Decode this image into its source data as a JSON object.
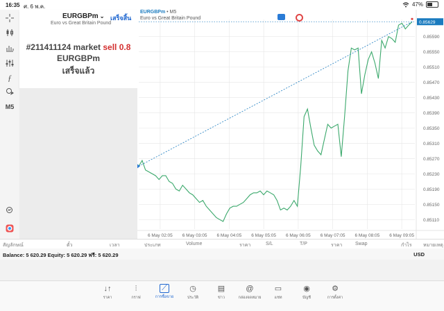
{
  "status_bar": {
    "time": "16:35",
    "date": "ศ. 6 พ.ค.",
    "battery": "47%"
  },
  "left_toolbar": {
    "timeframe": "M5"
  },
  "order_panel": {
    "symbol": "EURGBPm",
    "description": "Euro vs Great Britain Pound",
    "done_label": "เสร็จสิ้น",
    "result_line1_prefix": "#211411124 market ",
    "result_line1_action": "sell 0.8",
    "result_line2": "EURGBPm",
    "result_line3": "เสร็จแล้ว"
  },
  "chart": {
    "symbol": "EURGBPm",
    "timeframe": "• M5",
    "description": "Euro vs Great Britain Pound",
    "current_price": "0.85629",
    "colors": {
      "line": "#3aa86b",
      "grid": "#e6e6e6",
      "price_tag": "#1a7bbf",
      "dashed": "#1a7bbf"
    }
  },
  "chart_data": {
    "type": "line",
    "x_labels": [
      "6 May 02:05",
      "6 May 03:05",
      "6 May 04:05",
      "6 May 05:05",
      "6 May 06:05",
      "6 May 07:05",
      "6 May 08:05",
      "6 May 09:05"
    ],
    "y_labels": [
      "0.85590",
      "0.85550",
      "0.85510",
      "0.85470",
      "0.85430",
      "0.85390",
      "0.85350",
      "0.85310",
      "0.85270",
      "0.85230",
      "0.85190",
      "0.85150",
      "0.85110"
    ],
    "ylim": [
      0.85085,
      0.85635
    ],
    "values": [
      0.8525,
      0.85265,
      0.8524,
      0.85235,
      0.8523,
      0.85225,
      0.85215,
      0.85225,
      0.85225,
      0.8521,
      0.85205,
      0.8519,
      0.85185,
      0.852,
      0.8519,
      0.8518,
      0.85175,
      0.85165,
      0.85155,
      0.8516,
      0.85145,
      0.85135,
      0.85125,
      0.85115,
      0.8511,
      0.85105,
      0.85125,
      0.8514,
      0.85145,
      0.85145,
      0.8515,
      0.85155,
      0.85165,
      0.85175,
      0.8518,
      0.8518,
      0.85185,
      0.85175,
      0.85185,
      0.8518,
      0.85175,
      0.8516,
      0.85135,
      0.8514,
      0.85135,
      0.85145,
      0.8516,
      0.85145,
      0.8525,
      0.8538,
      0.854,
      0.8535,
      0.85305,
      0.8529,
      0.8528,
      0.8532,
      0.8536,
      0.8535,
      0.85355,
      0.8536,
      0.85275,
      0.8538,
      0.855,
      0.8556,
      0.85555,
      0.8556,
      0.8544,
      0.8549,
      0.8553,
      0.8555,
      0.8552,
      0.8548,
      0.8558,
      0.8556,
      0.8559,
      0.85585,
      0.85575,
      0.8562,
      0.85625,
      0.8561,
      0.8562,
      0.85629
    ]
  },
  "columns": [
    "สัญลักษณ์",
    "ตั๋ว",
    "เวลา",
    "ประเภท",
    "Volume",
    "ราคา",
    "S/L",
    "T/P",
    "ราคา",
    "Swap",
    "กำไร",
    "หมายเหตุ"
  ],
  "balance": {
    "text": "Balance: 5 620.29 Equity: 5 620.29 ฟรี: 5 620.29",
    "currency": "USD"
  },
  "tabs": [
    {
      "label": "ราคา",
      "icon": "↓↑"
    },
    {
      "label": "กราฟ",
      "icon": "⫶"
    },
    {
      "label": "การซื้อขาย",
      "icon": "⟋"
    },
    {
      "label": "ประวัติ",
      "icon": "◷"
    },
    {
      "label": "ข่าว",
      "icon": "▤"
    },
    {
      "label": "กล่องจดหมาย",
      "icon": "@"
    },
    {
      "label": "แชท",
      "icon": "▭"
    },
    {
      "label": "บัญชี",
      "icon": "◉"
    },
    {
      "label": "การตั้งค่า",
      "icon": "⚙"
    }
  ]
}
